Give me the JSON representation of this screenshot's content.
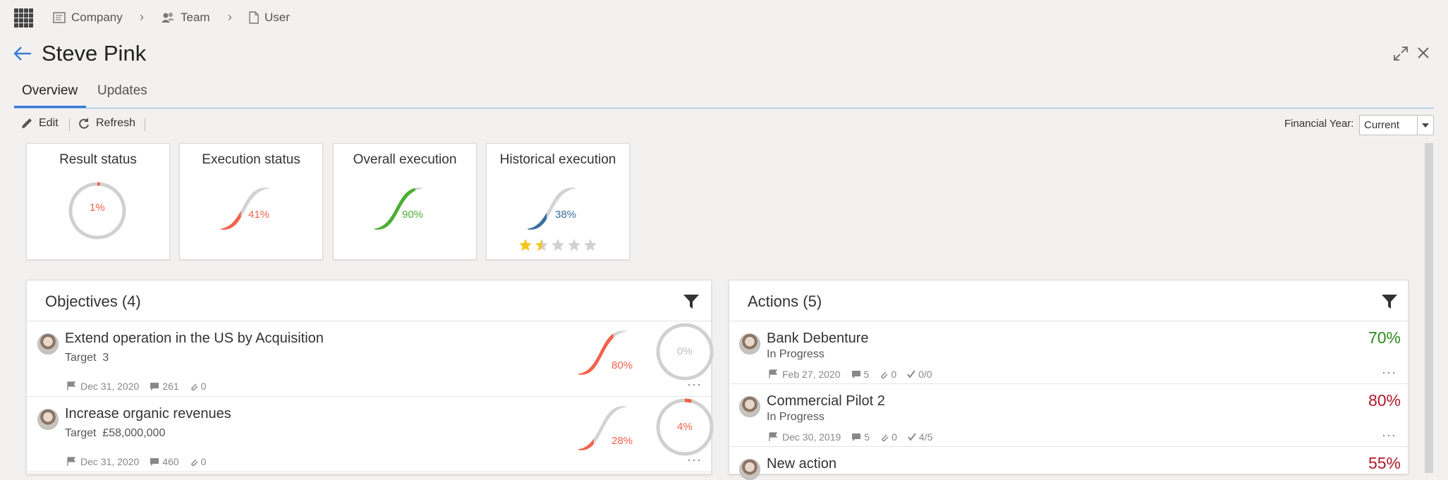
{
  "breadcrumb": [
    {
      "label": "Company",
      "icon": "company-icon"
    },
    {
      "label": "Team",
      "icon": "team-icon"
    },
    {
      "label": "User",
      "icon": "document-icon"
    }
  ],
  "page": {
    "title": "Steve Pink"
  },
  "tabs": [
    {
      "label": "Overview",
      "active": true
    },
    {
      "label": "Updates",
      "active": false
    }
  ],
  "toolbar": {
    "edit_label": "Edit",
    "refresh_label": "Refresh"
  },
  "financial_year": {
    "label": "Financial Year:",
    "value": "Current"
  },
  "kpis": [
    {
      "title": "Result status",
      "value": "1%",
      "fraction": 0.01,
      "color": "#f4614a",
      "style": "ring"
    },
    {
      "title": "Execution status",
      "value": "41%",
      "fraction": 0.41,
      "color": "#f4614a",
      "style": "wave"
    },
    {
      "title": "Overall execution",
      "value": "90%",
      "fraction": 0.9,
      "color": "#4caf34",
      "style": "wave"
    },
    {
      "title": "Historical execution",
      "value": "38%",
      "fraction": 0.38,
      "color": "#3a6f9f",
      "style": "wave",
      "rating": 1.5,
      "rating_max": 5
    }
  ],
  "objectives": {
    "title": "Objectives (4)",
    "items": [
      {
        "title": "Extend operation in the US by Acquisition",
        "target_label": "Target",
        "target": "3",
        "date": "Dec 31, 2020",
        "comments": "261",
        "attachments": "0",
        "progress": "80%",
        "progress_fraction": 0.8,
        "result": "0%",
        "result_fraction": 0.0
      },
      {
        "title": "Increase organic revenues",
        "target_label": "Target",
        "target": "£58,000,000",
        "date": "Dec 31, 2020",
        "comments": "460",
        "attachments": "0",
        "progress": "28%",
        "progress_fraction": 0.28,
        "result": "4%",
        "result_fraction": 0.04
      }
    ]
  },
  "actions": {
    "title": "Actions (5)",
    "items": [
      {
        "title": "Bank Debenture",
        "status": "In Progress",
        "date": "Feb 27, 2020",
        "comments": "5",
        "attachments": "0",
        "checks": "0/0",
        "pct": "70%",
        "pct_color": "#2e8b1f"
      },
      {
        "title": "Commercial Pilot 2",
        "status": "In Progress",
        "date": "Dec 30, 2019",
        "comments": "5",
        "attachments": "0",
        "checks": "4/5",
        "pct": "80%",
        "pct_color": "#b0192b"
      },
      {
        "title": "New action",
        "pct": "55%",
        "pct_color": "#b0192b"
      }
    ]
  },
  "colors": {
    "accent": "#3a7bd5",
    "red": "#f4614a",
    "green": "#4caf34",
    "blue": "#3a6f9f"
  }
}
